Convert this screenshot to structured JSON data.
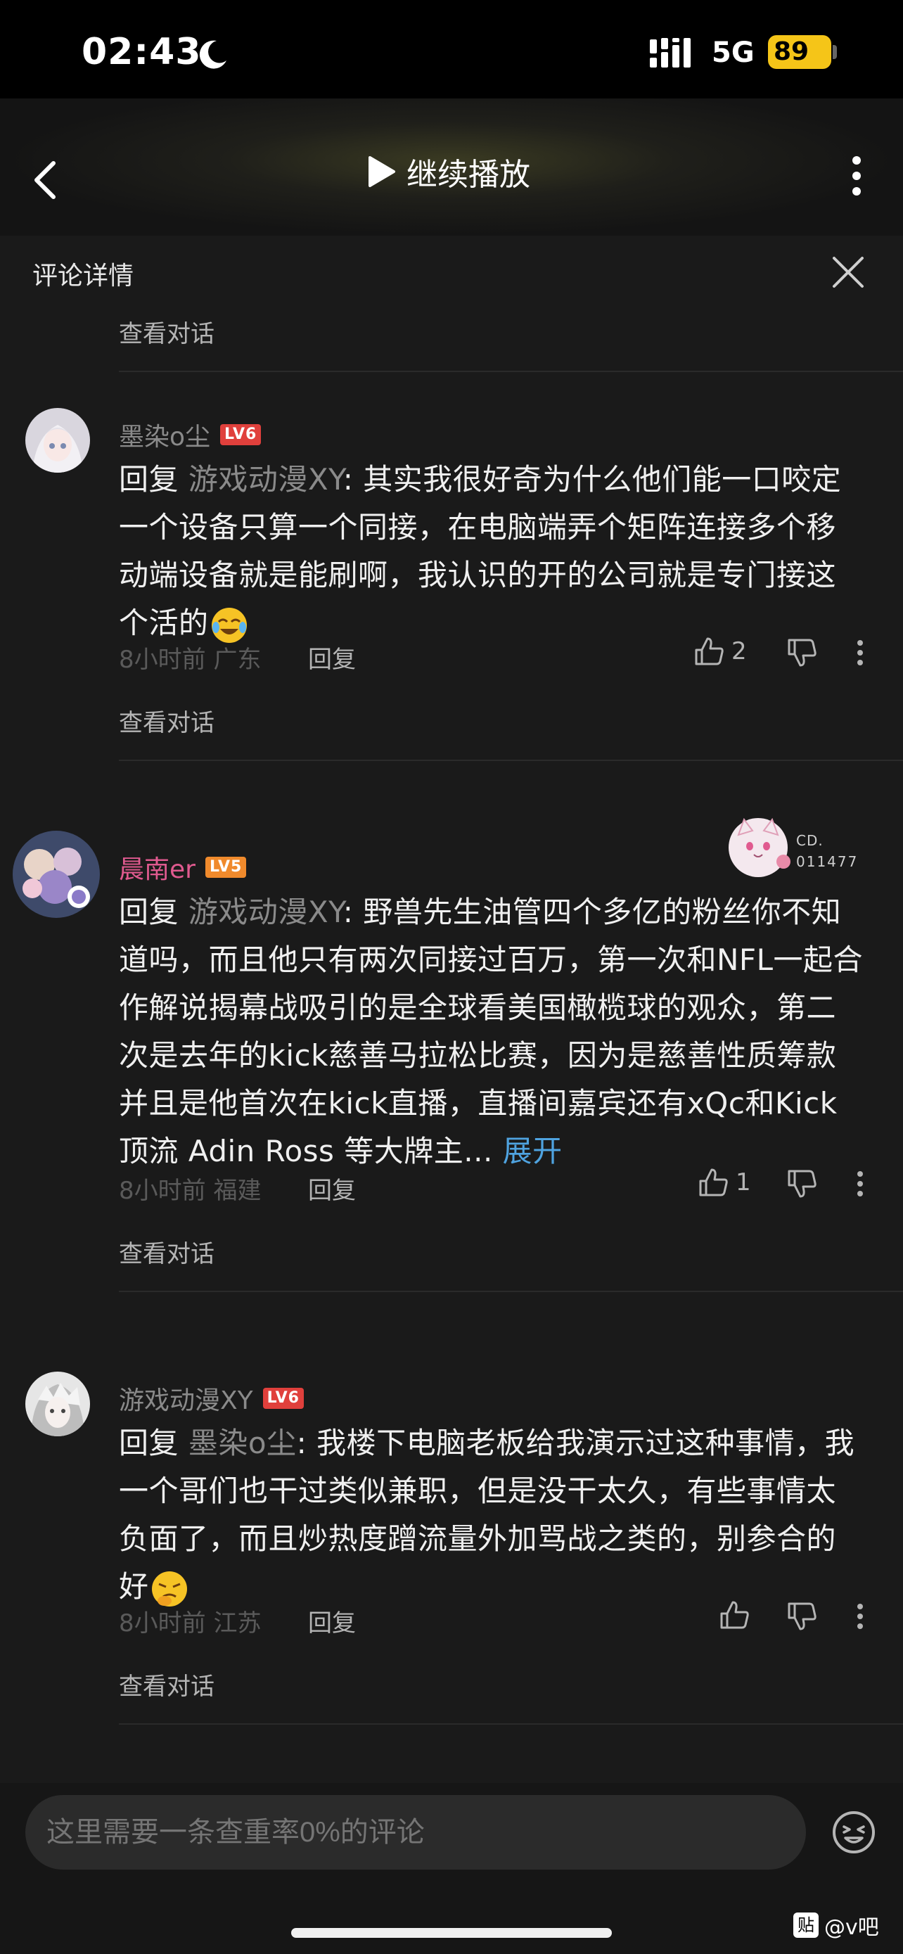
{
  "status": {
    "time": "02:43",
    "network": "5G",
    "battery": "89"
  },
  "top": {
    "play_label": "继续播放"
  },
  "panel": {
    "title": "评论详情",
    "view_dialog": "查看对话"
  },
  "comments": [
    {
      "user": "墨染o尘",
      "level": "LV6",
      "level_color": "#e0403c",
      "reply_prefix": "回复 ",
      "mention": "游戏动漫XY",
      "text": ": 其实我很好奇为什么他们能一口咬定一个设备只算一个同接，在电脑端弄个矩阵连接多个移动端设备就是能刷啊，我认识的开的公司就是专门接这个活的",
      "time": "8小时前",
      "location": "广东",
      "reply_label": "回复",
      "likes": "2",
      "emoji": "laugh-cry-emoji"
    },
    {
      "user": "晨南er",
      "level": "LV5",
      "level_color": "#f08a2c",
      "reply_prefix": "回复 ",
      "mention": "游戏动漫XY",
      "text": ": 野兽先生油管四个多亿的粉丝你不知道吗，而且他只有两次同接过百万，第一次和NFL一起合作解说揭幕战吸引的是全球看美国橄榄球的观众，第二次是去年的kick慈善马拉松比赛，因为是慈善性质筹款并且是他首次在kick直播，直播间嘉宾还有xQc和Kick顶流 Adin Ross 等大牌主... ",
      "expand": "展开",
      "badge_text": "CD.",
      "badge_number": "011477",
      "time": "8小时前",
      "location": "福建",
      "reply_label": "回复",
      "likes": "1"
    },
    {
      "user": "游戏动漫XY",
      "level": "LV6",
      "level_color": "#e0403c",
      "reply_prefix": "回复 ",
      "mention": "墨染o尘",
      "text": ": 我楼下电脑老板给我演示过这种事情，我一个哥们也干过类似兼职，但是没干太久，有些事情太负面了，而且炒热度蹭流量外加骂战之类的，别参合的好",
      "time": "8小时前",
      "location": "江苏",
      "reply_label": "回复",
      "likes": "",
      "emoji": "thinking-emoji"
    }
  ],
  "input": {
    "placeholder": "这里需要一条查重率0%的评论"
  },
  "watermark": {
    "logo": "贴",
    "text": "@v吧"
  }
}
